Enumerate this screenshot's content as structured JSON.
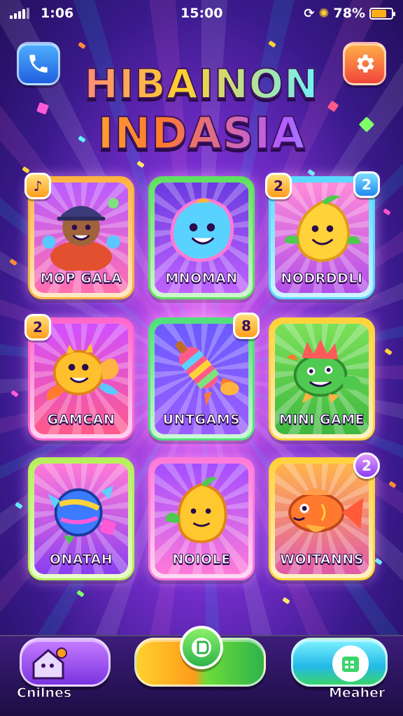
{
  "status_bar": {
    "time_left": "1:06",
    "time_center": "15:00",
    "battery_percent": "78%",
    "battery_level": 0.7
  },
  "header": {
    "title_line1": "HIBAINON",
    "title_line2": "INDASIA",
    "left_button_icon": "phone-icon",
    "right_button_icon": "gear-icon"
  },
  "games": [
    {
      "label": "MOP GALA",
      "badge": "♪",
      "frame": "#ffb340",
      "art": "singer-character"
    },
    {
      "label": "MNOMAN",
      "badge": "",
      "frame": "#5fe05f",
      "art": "blue-blob-creature"
    },
    {
      "label": "NODRDDLI",
      "badge": "2",
      "badge_right": "2",
      "frame": "#5ad8ff",
      "art": "yellow-fruit-creature"
    },
    {
      "label": "GAMCAN",
      "badge": "2",
      "frame": "#ff66cc",
      "art": "yellow-fish-creature"
    },
    {
      "label": "UNTGAMS",
      "badge": "8",
      "frame": "#4fe07a",
      "art": "rocket-candy"
    },
    {
      "label": "MINI GAME",
      "badge": "",
      "frame": "#ffd23a",
      "art": "green-dragon"
    },
    {
      "label": "ONATAH",
      "badge": "",
      "frame": "#b6f05a",
      "art": "candy-ball"
    },
    {
      "label": "NOIOLE",
      "badge": "",
      "frame": "#ff7ad8",
      "art": "mango-creature"
    },
    {
      "label": "WOITANNS",
      "badge": "2",
      "frame": "#ffd23a",
      "art": "orange-fish"
    }
  ],
  "bottom_bar": {
    "left_label": "Cnilnes",
    "right_label": "Meaher",
    "left_icon": "house-icon",
    "center_icon": "chat-icon",
    "right_icon": "calendar-icon"
  }
}
